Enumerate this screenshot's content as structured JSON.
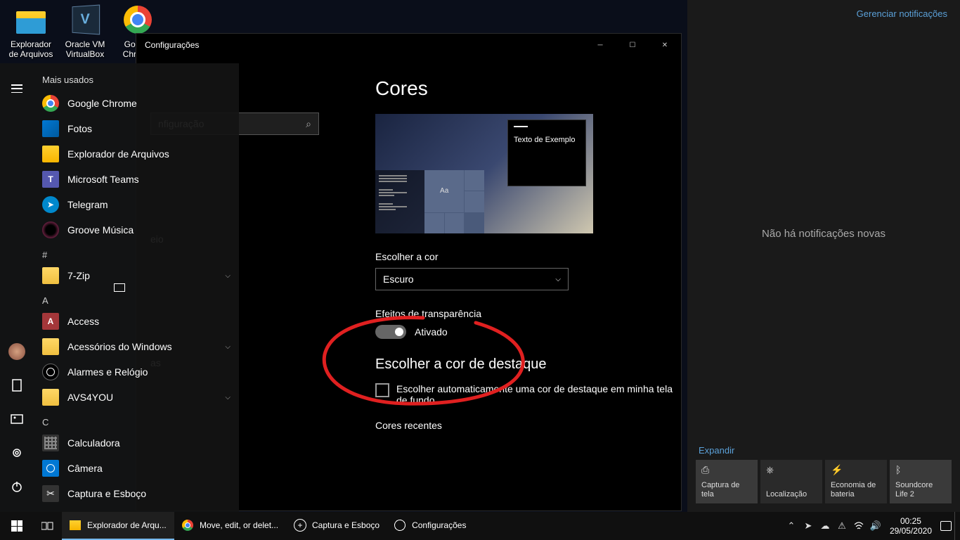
{
  "desktop": {
    "icons": [
      {
        "label": "Explorador de Arquivos"
      },
      {
        "label": "Oracle VM VirtualBox"
      },
      {
        "label": "Google Chrome"
      }
    ]
  },
  "settings": {
    "window_title": "Configurações",
    "search_placeholder": "nfiguração",
    "nav_partial": "eio",
    "nav_partial2": "as",
    "page_title": "Cores",
    "preview_sample": "Texto de Exemplo",
    "preview_aa": "Aa",
    "choose_color_label": "Escolher a cor",
    "color_mode": "Escuro",
    "transparency_label": "Efeitos de transparência",
    "transparency_state": "Ativado",
    "accent_title": "Escolher a cor de destaque",
    "auto_pick_label": "Escolher automaticamente uma cor de destaque em minha tela de fundo",
    "recent_colors_label": "Cores recentes"
  },
  "start_menu": {
    "header": "Mais usados",
    "most_used": [
      "Google Chrome",
      "Fotos",
      "Explorador de Arquivos",
      "Microsoft Teams",
      "Telegram",
      "Groove Música"
    ],
    "sections": [
      {
        "letter": "#",
        "items": [
          {
            "name": "7-Zip",
            "expandable": true
          }
        ]
      },
      {
        "letter": "A",
        "items": [
          {
            "name": "Access",
            "expandable": false
          },
          {
            "name": "Acessórios do Windows",
            "expandable": true
          },
          {
            "name": "Alarmes e Relógio",
            "expandable": false
          },
          {
            "name": "AVS4YOU",
            "expandable": true
          }
        ]
      },
      {
        "letter": "C",
        "items": [
          {
            "name": "Calculadora",
            "expandable": false
          },
          {
            "name": "Câmera",
            "expandable": false
          },
          {
            "name": "Captura e Esboço",
            "expandable": false
          }
        ]
      }
    ]
  },
  "action_center": {
    "manage": "Gerenciar notificações",
    "empty": "Não há notificações novas",
    "expand": "Expandir",
    "tiles": [
      "Captura de tela",
      "Localização",
      "Economia de bateria",
      "Soundcore Life 2"
    ]
  },
  "taskbar": {
    "items": [
      "Explorador de Arqu...",
      "Move, edit, or delet...",
      "Captura e Esboço",
      "Configurações"
    ],
    "clock_time": "00:25",
    "clock_date": "29/05/2020"
  }
}
